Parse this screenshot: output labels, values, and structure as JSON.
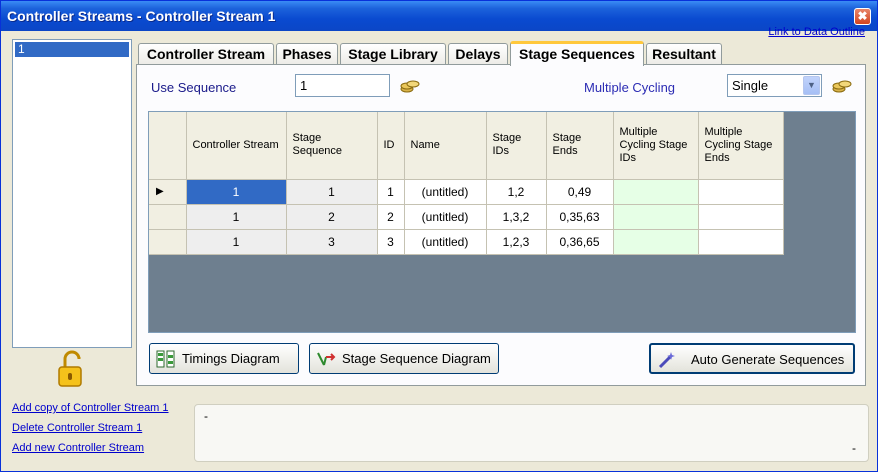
{
  "window": {
    "title": "Controller Streams - Controller Stream 1",
    "close_label": "✖"
  },
  "link_outline": "Link to Data Outline",
  "stream_list": {
    "items": [
      "1"
    ]
  },
  "tabs": [
    {
      "label": "Controller Stream",
      "active": false
    },
    {
      "label": "Phases",
      "active": false
    },
    {
      "label": "Stage Library",
      "active": false
    },
    {
      "label": "Delays",
      "active": false
    },
    {
      "label": "Stage Sequences",
      "active": true
    },
    {
      "label": "Resultant",
      "active": false
    }
  ],
  "form": {
    "use_sequence_label": "Use Sequence",
    "use_sequence_value": "1",
    "multiple_cycling_label": "Multiple Cycling",
    "multiple_cycling_value": "Single"
  },
  "table": {
    "headers": {
      "controller_stream": "Controller Stream",
      "stage_sequence": "Stage Sequence",
      "id": "ID",
      "name": "Name",
      "stage_ids": "Stage IDs",
      "stage_ends": "Stage Ends",
      "mc_stage_ids": "Multiple Cycling Stage IDs",
      "mc_stage_ends": "Multiple Cycling Stage Ends"
    },
    "current_row_marker": "▶",
    "rows": [
      {
        "controller_stream": "1",
        "stage_sequence": "1",
        "id": "1",
        "name": "(untitled)",
        "stage_ids": "1,2",
        "stage_ends": "0,49",
        "mc_stage_ids": "",
        "mc_stage_ends": ""
      },
      {
        "controller_stream": "1",
        "stage_sequence": "2",
        "id": "2",
        "name": "(untitled)",
        "stage_ids": "1,3,2",
        "stage_ends": "0,35,63",
        "mc_stage_ids": "",
        "mc_stage_ends": ""
      },
      {
        "controller_stream": "1",
        "stage_sequence": "3",
        "id": "3",
        "name": "(untitled)",
        "stage_ids": "1,2,3",
        "stage_ends": "0,36,65",
        "mc_stage_ids": "",
        "mc_stage_ends": ""
      }
    ]
  },
  "buttons": {
    "timings_diagram": "Timings Diagram",
    "stage_sequence_diagram": "Stage Sequence Diagram",
    "auto_generate": "Auto Generate Sequences"
  },
  "bottom_links": {
    "add_copy": "Add copy of Controller Stream 1",
    "delete": "Delete Controller Stream 1",
    "add_new": "Add new Controller Stream"
  },
  "messages": {
    "top": "-",
    "bottom": "-"
  },
  "colors": {
    "titlebar": "#0A4AD0",
    "selection": "#316AC5",
    "grid_bg": "#6E7F8F",
    "mc_cell": "#E6FFE6",
    "active_tab_accent": "#FFC83C"
  }
}
